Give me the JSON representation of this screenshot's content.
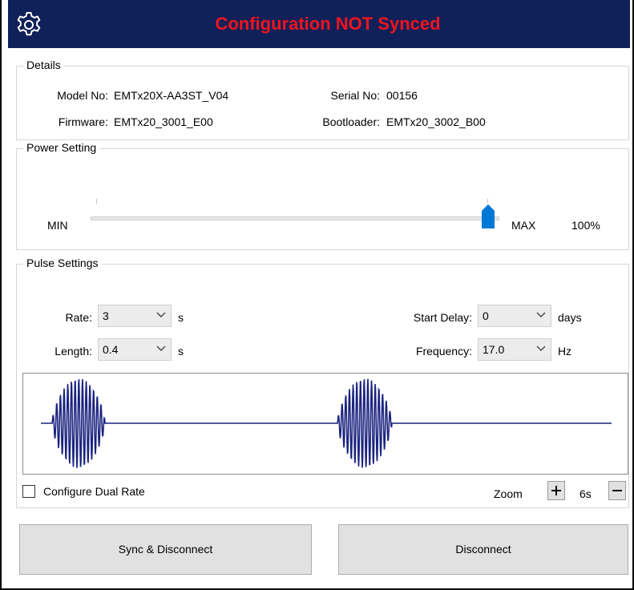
{
  "header": {
    "title": "Configuration NOT Synced",
    "icon": "gear-icon",
    "bg_color": "#102058",
    "title_color": "#f0141e"
  },
  "details": {
    "legend": "Details",
    "model_label": "Model No:",
    "model_value": "EMTx20X-AA3ST_V04",
    "serial_label": "Serial No:",
    "serial_value": "00156",
    "firmware_label": "Firmware:",
    "firmware_value": "EMTx20_3001_E00",
    "bootloader_label": "Bootloader:",
    "bootloader_value": "EMTx20_3002_B00"
  },
  "power": {
    "legend": "Power Setting",
    "min_label": "MIN",
    "max_label": "MAX",
    "value_text": "100%",
    "level": 1.0,
    "thumb_color": "#0078d7"
  },
  "pulse": {
    "legend": "Pulse Settings",
    "rate_label": "Rate:",
    "rate_value": "3",
    "rate_unit": "s",
    "length_label": "Length:",
    "length_value": "0.4",
    "length_unit": "s",
    "start_delay_label": "Start Delay:",
    "start_delay_value": "0",
    "start_delay_unit": "days",
    "frequency_label": "Frequency:",
    "frequency_value": "17.0",
    "frequency_unit": "Hz",
    "wave_color": "#1a237e"
  },
  "options": {
    "dual_rate_label": "Configure Dual Rate",
    "dual_rate_checked": false,
    "zoom_label": "Zoom",
    "zoom_value": "6s"
  },
  "buttons": {
    "sync": "Sync & Disconnect",
    "disconnect": "Disconnect"
  }
}
